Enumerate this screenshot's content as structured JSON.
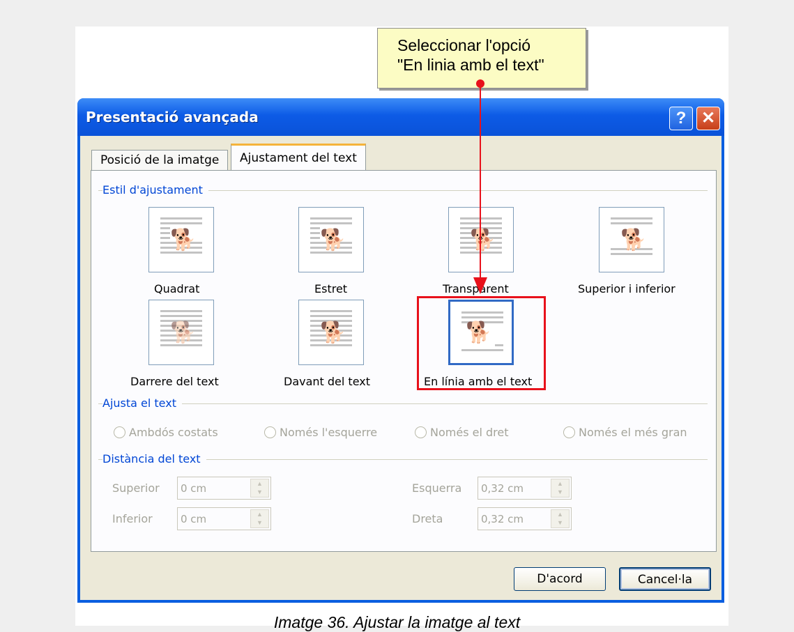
{
  "callout": {
    "text": "Seleccionar l'opció\n\"En linia amb el text\""
  },
  "window": {
    "title": "Presentació avançada",
    "help_label": "?",
    "close_label": "✕"
  },
  "tabs": [
    {
      "label": "Posició de la imatge"
    },
    {
      "label": "Ajustament del text"
    }
  ],
  "wrap_style": {
    "group_label": "Estil d'ajustament",
    "options": [
      {
        "label": "Quadrat"
      },
      {
        "label": "Estret"
      },
      {
        "label": "Transparent"
      },
      {
        "label": "Superior i inferior"
      },
      {
        "label": "Darrere del text"
      },
      {
        "label": "Davant del text"
      },
      {
        "label": "En línia amb el text",
        "selected": true
      }
    ]
  },
  "wrap_text": {
    "group_label": "Ajusta el text",
    "options": [
      "Ambdós costats",
      "Només l'esquerre",
      "Només el dret",
      "Només el més gran"
    ]
  },
  "distance": {
    "group_label": "Distància del text",
    "top_label": "Superior",
    "top_value": "0 cm",
    "bottom_label": "Inferior",
    "bottom_value": "0 cm",
    "left_label": "Esquerra",
    "left_value": "0,32 cm",
    "right_label": "Dreta",
    "right_value": "0,32 cm"
  },
  "buttons": {
    "ok": "D'acord",
    "cancel": "Cancel·la"
  },
  "caption": "Imatge 36. Ajustar la imatge al text",
  "colors": {
    "highlight": "#e8111b",
    "titlebar": "#0a5ee0",
    "group_label": "#0046d5"
  },
  "icons": {
    "wrap_option": "dog-silhouette-icon"
  }
}
